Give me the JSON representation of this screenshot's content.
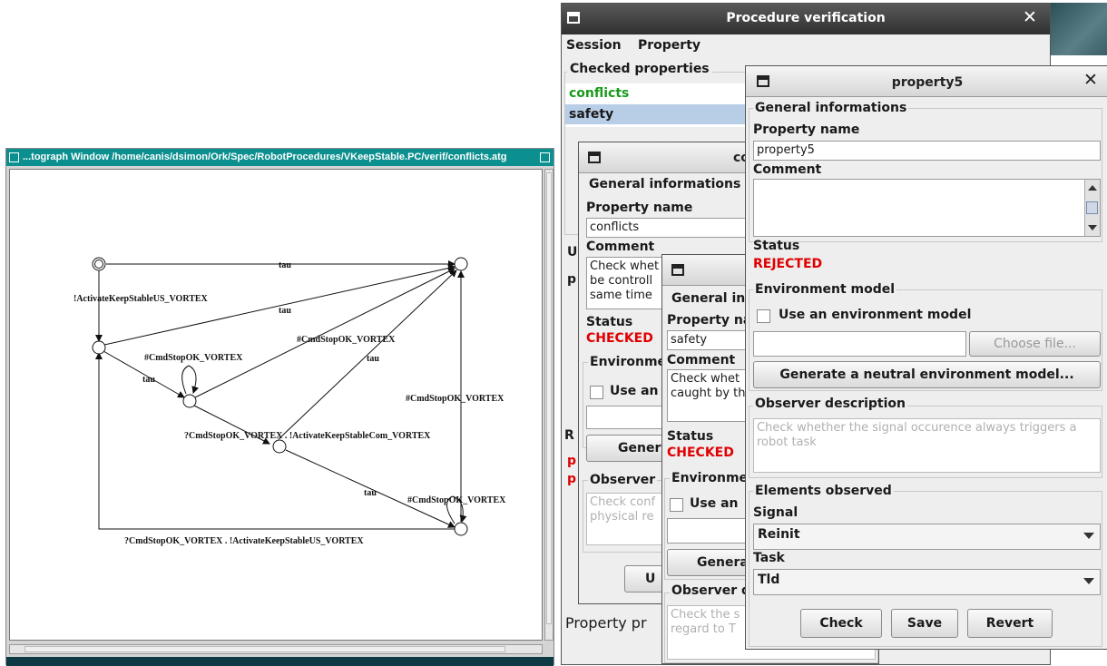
{
  "autograph": {
    "title": "...tograph Window   /home/canis/dsimon/Ork/Spec/RobotProcedures/VKeepStable.PC/verif/conflicts.atg",
    "graph_labels": {
      "tau_top": "tau",
      "activate_us": "!ActivateKeepStableUS_VORTEX",
      "tau_diag": "tau",
      "cmdstop_loop": "#CmdStopOK_VORTEX",
      "cmdstop_mid": "#CmdStopOK_VORTEX",
      "tau_left": "tau",
      "tau_mid": "tau",
      "cmdstop_right": "#CmdStopOK_VORTEX",
      "activate_com": "?CmdStopOK_VORTEX . !ActivateKeepStableCom_VORTEX",
      "tau_low": "tau",
      "cmdstop_low": "#CmdStopOK_VORTEX",
      "bottom_edge": "?CmdStopOK_VORTEX . !ActivateKeepStableUS_VORTEX"
    }
  },
  "procedure": {
    "title": "Procedure verification",
    "menu": [
      "Session",
      "Property"
    ],
    "checked_properties_label": "Checked properties",
    "properties": [
      "conflicts",
      "safety"
    ],
    "partial_labels": {
      "u": "U",
      "p": "p",
      "r": "R",
      "p_red1": "p",
      "p_red2": "p",
      "property_pr": "Property pr"
    }
  },
  "dlg_conflicts": {
    "title_partial": "co",
    "general": "General informations",
    "property_name_label": "Property name",
    "property_name": "conflicts",
    "comment_label": "Comment",
    "comment_lines": [
      "Check whet",
      "be controll",
      "same time"
    ],
    "status_label": "Status",
    "status": "CHECKED",
    "environment_label": "Environme",
    "use_env": "Use an",
    "generate": "Gener",
    "observer": "Observer",
    "observer_lines": [
      "Check conf",
      "physical re"
    ],
    "unknown_button": "U"
  },
  "dlg_safety": {
    "general": "General inf",
    "property_name_label": "Property na",
    "property_name": "safety",
    "comment_label": "Comment",
    "comment_lines": [
      "Check whet",
      "caught by th"
    ],
    "status_label": "Status",
    "status": "CHECKED",
    "environment_label": "Environme",
    "use_env": "Use an",
    "generate": "Genera",
    "observer": "Observer d",
    "observer_lines": [
      "Check the s",
      "regard to T"
    ]
  },
  "dlg_property5": {
    "title": "property5",
    "general": "General informations",
    "property_name_label": "Property name",
    "property_name": "property5",
    "comment_label": "Comment",
    "comment": "",
    "status_label": "Status",
    "status": "REJECTED",
    "environment_label": "Environment model",
    "use_env": "Use an environment model",
    "env_file": "",
    "choose_file": "Choose file...",
    "generate_neutral": "Generate a neutral environment model...",
    "observer_label": "Observer description",
    "observer_text": "Check whether the signal occurence always triggers a robot task",
    "elements_label": "Elements observed",
    "signal_label": "Signal",
    "signal_value": "Reinit",
    "task_label": "Task",
    "task_value": "Tld",
    "check": "Check",
    "save": "Save",
    "revert": "Revert"
  },
  "colors": {
    "autograph_titlebar": "#0b8f8f",
    "status_red": "#e00000",
    "conflicts_green": "#1a9a1a",
    "selection": "#b8cde6"
  },
  "icons": {
    "window_menu": "window-menu-icon",
    "close": "close-icon",
    "dropdown": "chevron-down-icon"
  }
}
